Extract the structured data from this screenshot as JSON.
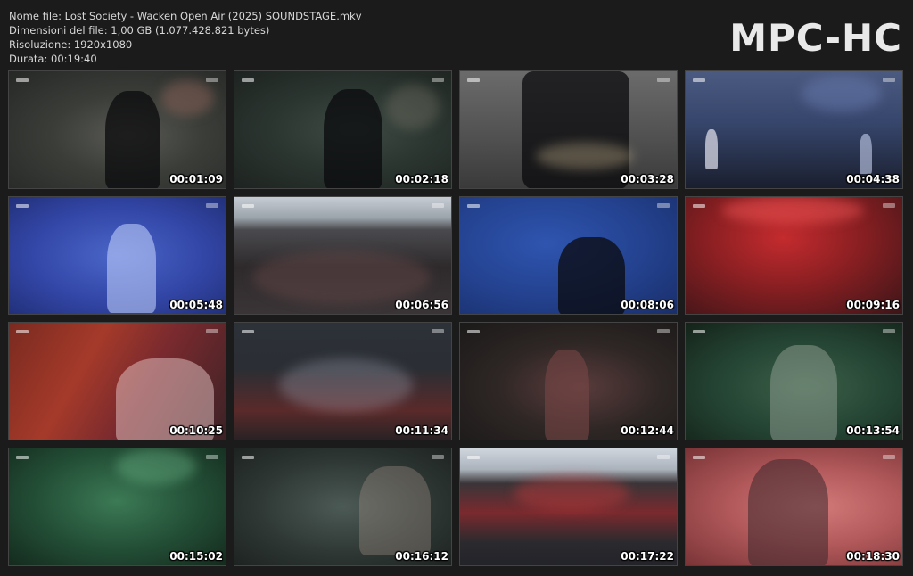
{
  "info": {
    "filename": "Nome file: Lost Society - Wacken Open Air (2025) SOUNDSTAGE.mkv",
    "filesize": "Dimensioni del file: 1,00 GB (1.077.428.821 bytes)",
    "resolution": "Risoluzione: 1920x1080",
    "duration": "Durata: 00:19:40"
  },
  "logo": "MPC-HC",
  "thumbnails": [
    {
      "time": "00:01:09",
      "art": "a1"
    },
    {
      "time": "00:02:18",
      "art": "a2"
    },
    {
      "time": "00:03:28",
      "art": "a3"
    },
    {
      "time": "00:04:38",
      "art": "a4"
    },
    {
      "time": "00:05:48",
      "art": "a5"
    },
    {
      "time": "00:06:56",
      "art": "a6"
    },
    {
      "time": "00:08:06",
      "art": "a7"
    },
    {
      "time": "00:09:16",
      "art": "a8"
    },
    {
      "time": "00:10:25",
      "art": "a9"
    },
    {
      "time": "00:11:34",
      "art": "a10"
    },
    {
      "time": "00:12:44",
      "art": "a11"
    },
    {
      "time": "00:13:54",
      "art": "a12"
    },
    {
      "time": "00:15:02",
      "art": "a13"
    },
    {
      "time": "00:16:12",
      "art": "a14"
    },
    {
      "time": "00:17:22",
      "art": "a15"
    },
    {
      "time": "00:18:30",
      "art": "a16"
    }
  ]
}
